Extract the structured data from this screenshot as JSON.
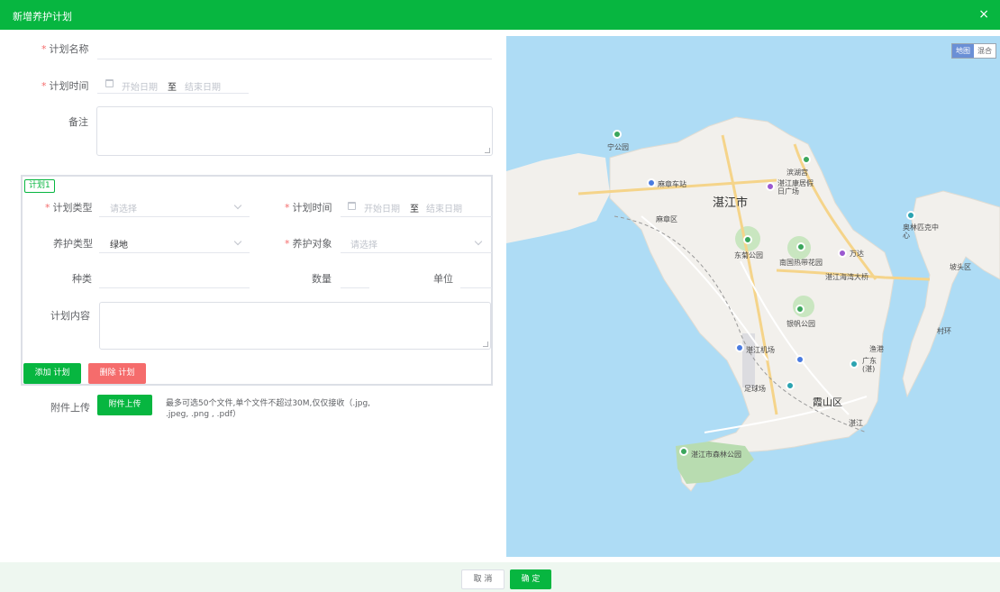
{
  "dialog": {
    "title": "新增养护计划",
    "close_symbol": "×"
  },
  "form": {
    "plan_name_label": "计划名称",
    "plan_time_label": "计划时间",
    "start_placeholder": "开始日期",
    "to_text": "至",
    "end_placeholder": "结束日期",
    "remark_label": "备注",
    "required_mark": "*"
  },
  "plan": {
    "tag": "计划1",
    "type_label": "计划类型",
    "type_placeholder": "请选择",
    "time_label": "计划时间",
    "start_placeholder": "开始日期",
    "to_text": "至",
    "end_placeholder": "结束日期",
    "maint_type_label": "养护类型",
    "maint_type_value": "绿地",
    "target_label": "养护对象",
    "target_placeholder": "请选择",
    "species_label": "种类",
    "quantity_label": "数量",
    "unit_label": "单位",
    "content_label": "计划内容",
    "add_button": "添加 计划",
    "delete_button": "删除 计划"
  },
  "attachment": {
    "label": "附件上传",
    "button": "附件上传",
    "hint": "最多可选50个文件,单个文件不超过30M,仅仅接收（.jpg, .jpeg, .png , .pdf）"
  },
  "footer": {
    "cancel": "取 消",
    "confirm": "确 定"
  },
  "map": {
    "mode_map": "地图",
    "mode_hybrid": "混合",
    "labels": {
      "city": "湛江市",
      "mazhang_district": "麻章区",
      "mazhang_station": "麻章车站",
      "park1": "宁公园",
      "binhu": "滨湖宫",
      "plaza": "湛江康居假日广场",
      "dongju_park": "东菊公园",
      "tropical_garden": "南国热带花园",
      "wanda": "万达",
      "bridge": "湛江海湾大桥",
      "yinfan_park": "银帆公园",
      "airport": "湛江机场",
      "guangdong": "广东(湛)",
      "yugang": "渔港",
      "golf": "足球场",
      "xiashan": "霞山区",
      "zhanjiang_s": "湛江",
      "forest_park": "湛江市森林公园",
      "olympic": "奥林匹克中心",
      "potou": "坡头区",
      "village": "村环"
    }
  }
}
